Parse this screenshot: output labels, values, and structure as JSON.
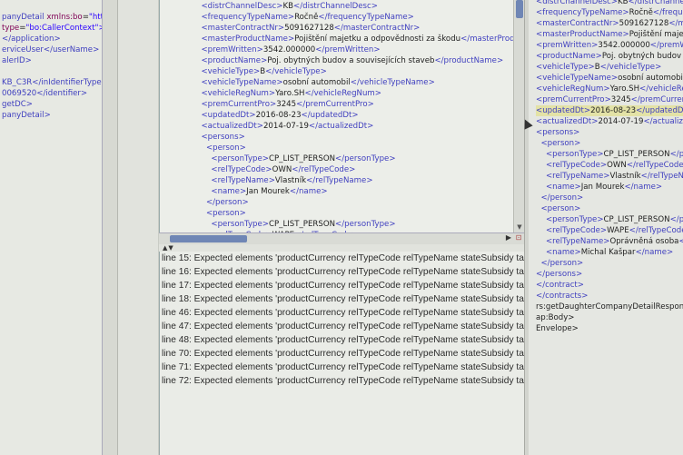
{
  "left_lines": [
    {
      "pre": "panyDetail ",
      "attr": "xmlns:bo",
      "eq": "=",
      "val": "\"http://"
    },
    {
      "pre": "",
      "attr": "type",
      "eq": "=",
      "val": "\"bo:CallerContext\">"
    },
    {
      "pre": "</application>",
      "attr": "",
      "eq": "",
      "val": ""
    },
    {
      "pre": "erviceUser</userName>",
      "attr": "",
      "eq": "",
      "val": ""
    },
    {
      "pre": "alerID>",
      "attr": "",
      "eq": "",
      "val": ""
    },
    {
      "pre": "",
      "attr": "",
      "eq": "",
      "val": ""
    },
    {
      "pre": "KB_C3R</inIdentifierType>",
      "attr": "",
      "eq": "",
      "val": ""
    },
    {
      "pre": "0069520</identifier>",
      "attr": "",
      "eq": "",
      "val": ""
    },
    {
      "pre": "getDC>",
      "attr": "",
      "eq": "",
      "val": ""
    },
    {
      "pre": "panyDetail>",
      "attr": "",
      "eq": "",
      "val": ""
    }
  ],
  "center_lines": [
    {
      "indent": "  ",
      "text": "<distrChannelDesc>KB</distrChannelDesc>"
    },
    {
      "indent": "  ",
      "text": "<frequencyTypeName>Ročně</frequencyTypeName>"
    },
    {
      "indent": "  ",
      "text": "<masterContractNr>5091627128</masterContractNr>"
    },
    {
      "indent": "  ",
      "text": "<masterProductName>Pojištění majetku a odpovědnosti za škodu</masterProductName>"
    },
    {
      "indent": "  ",
      "text": "<premWritten>3542.000000</premWritten>"
    },
    {
      "indent": "  ",
      "text": "<productName>Poj. obytných budov a souvisejících staveb</productName>"
    },
    {
      "indent": "  ",
      "text": "<vehicleType>B</vehicleType>"
    },
    {
      "indent": "  ",
      "text": "<vehicleTypeName>osobní automobil</vehicleTypeName>"
    },
    {
      "indent": "  ",
      "text": "<vehicleRegNum>Yaro.SH</vehicleRegNum>"
    },
    {
      "indent": "  ",
      "text": "<premCurrentPro>3245</premCurrentPro>"
    },
    {
      "indent": "  ",
      "text": "<updatedDt>2016-08-23</updatedDt>"
    },
    {
      "indent": "  ",
      "text": "<actualizedDt>2014-07-19</actualizedDt>"
    },
    {
      "indent": "  ",
      "text": "<persons>"
    },
    {
      "indent": "    ",
      "text": "<person>"
    },
    {
      "indent": "      ",
      "text": "<personType>CP_LIST_PERSON</personType>"
    },
    {
      "indent": "      ",
      "text": "<relTypeCode>OWN</relTypeCode>"
    },
    {
      "indent": "      ",
      "text": "<relTypeName>Vlastník</relTypeName>"
    },
    {
      "indent": "      ",
      "text": "<name>Jan Mourek</name>"
    },
    {
      "indent": "    ",
      "text": "</person>"
    },
    {
      "indent": "    ",
      "text": "<person>"
    },
    {
      "indent": "      ",
      "text": "<personType>CP_LIST_PERSON</personType>"
    },
    {
      "indent": "      ",
      "text": "<relTypeCode>WAPE</relTypeCode>"
    }
  ],
  "problems": [
    "line 15: Expected elements 'productCurrency relTypeCode relTypeName stateSubsidy targetA",
    "line 16: Expected elements 'productCurrency relTypeCode relTypeName stateSubsidy targetA",
    "line 17: Expected elements 'productCurrency relTypeCode relTypeName stateSubsidy targetA",
    "line 18: Expected elements 'productCurrency relTypeCode relTypeName stateSubsidy targetA",
    "line 46: Expected elements 'productCurrency relTypeCode relTypeName stateSubsidy targetA",
    "line 47: Expected elements 'productCurrency relTypeCode relTypeName stateSubsidy targetA",
    "line 48: Expected elements 'productCurrency relTypeCode relTypeName stateSubsidy targetA",
    "line 70: Expected elements 'productCurrency relTypeCode relTypeName stateSubsidy targetA",
    "line 71: Expected elements 'productCurrency relTypeCode relTypeName stateSubsidy targetA",
    "line 72: Expected elements 'productCurrency relTypeCode relTypeName stateSubsidy targetA"
  ],
  "right_lines": [
    {
      "indent": "",
      "text": "<distrChannelDesc>KB</distrChannelDesc>",
      "hl": false
    },
    {
      "indent": "",
      "text": "<frequencyTypeName>Ročně</frequencyTypeName>",
      "hl": false
    },
    {
      "indent": "",
      "text": "<masterContractNr>5091627128</masterContractNr>",
      "hl": false
    },
    {
      "indent": "",
      "text": "<masterProductName>Pojištění majetku a odpovědnosti",
      "hl": false
    },
    {
      "indent": "",
      "text": "<premWritten>3542.000000</premWritten>",
      "hl": false
    },
    {
      "indent": "",
      "text": "<productName>Poj. obytných budov a souvisejících",
      "hl": false
    },
    {
      "indent": "",
      "text": "<vehicleType>B</vehicleType>",
      "hl": false
    },
    {
      "indent": "",
      "text": "<vehicleTypeName>osobní automobil</vehicleTypeName>",
      "hl": false
    },
    {
      "indent": "",
      "text": "<vehicleRegNum>Yaro.SH</vehicleRegNum>",
      "hl": false
    },
    {
      "indent": "",
      "text": "<premCurrentPro>3245</premCurrentPro>",
      "hl": false
    },
    {
      "indent": "",
      "text": "<updatedDt>2016-08-23</updatedDt>",
      "hl": true
    },
    {
      "indent": "",
      "text": "<actualizedDt>2014-07-19</actualizedDt>",
      "hl": false
    },
    {
      "indent": "",
      "text": "<persons>",
      "hl": false
    },
    {
      "indent": "  ",
      "text": "<person>",
      "hl": false
    },
    {
      "indent": "    ",
      "text": "<personType>CP_LIST_PERSON</personType>",
      "hl": false
    },
    {
      "indent": "    ",
      "text": "<relTypeCode>OWN</relTypeCode>",
      "hl": false
    },
    {
      "indent": "    ",
      "text": "<relTypeName>Vlastník</relTypeName>",
      "hl": false
    },
    {
      "indent": "    ",
      "text": "<name>Jan Mourek</name>",
      "hl": false
    },
    {
      "indent": "  ",
      "text": "</person>",
      "hl": false
    },
    {
      "indent": "  ",
      "text": "<person>",
      "hl": false
    },
    {
      "indent": "    ",
      "text": "<personType>CP_LIST_PERSON</personType>",
      "hl": false
    },
    {
      "indent": "    ",
      "text": "<relTypeCode>WAPE</relTypeCode>",
      "hl": false
    },
    {
      "indent": "    ",
      "text": "<relTypeName>Oprávněná osoba</relTypeName>",
      "hl": false
    },
    {
      "indent": "    ",
      "text": "<name>Michal Kašpar</name>",
      "hl": false
    },
    {
      "indent": "  ",
      "text": "</person>",
      "hl": false
    },
    {
      "indent": "",
      "text": "</persons>",
      "hl": false
    },
    {
      "indent": "",
      "text": "</contract>",
      "hl": false
    },
    {
      "indent": "",
      "text": "</contracts>",
      "hl": false
    },
    {
      "indent": "",
      "text": "rs:getDaughterCompanyDetailResponse>",
      "hl": false
    },
    {
      "indent": "",
      "text": "ap:Body>",
      "hl": false
    },
    {
      "indent": "",
      "text": "Envelope>",
      "hl": false
    }
  ],
  "colors": {
    "tag": "#3f3fbf",
    "highlight": "#e3e2a6",
    "scroll": "#6f86b5"
  }
}
